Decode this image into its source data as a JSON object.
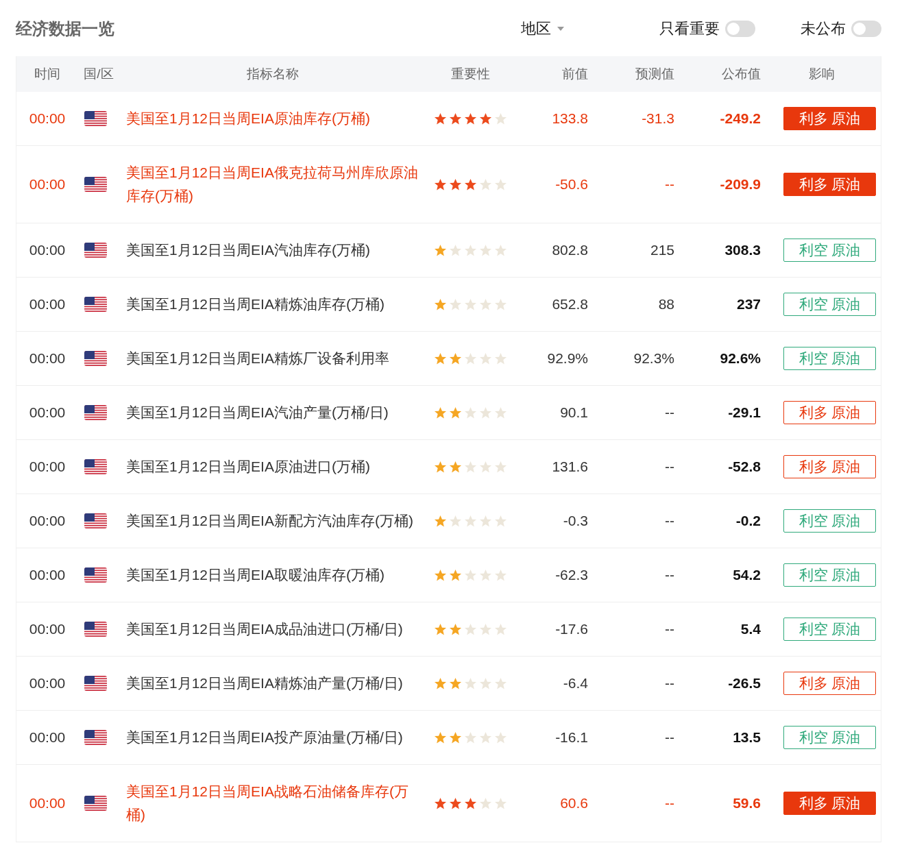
{
  "title": "经济数据一览",
  "filters": {
    "region": {
      "label": "地区"
    },
    "toggles": [
      {
        "label": "只看重要",
        "on": false
      },
      {
        "label": "未公布",
        "on": false
      }
    ]
  },
  "columns": [
    "时间",
    "国/区",
    "指标名称",
    "重要性",
    "前值",
    "预测值",
    "公布值",
    "影响"
  ],
  "rows": [
    {
      "time": "00:00",
      "highlight": true,
      "name": "美国至1月12日当周EIA原油库存(万桶)",
      "stars": 4,
      "previous": "133.8",
      "forecast": "-31.3",
      "actual": "-249.2",
      "impact": {
        "label": "利多 原油",
        "kind": "bullish",
        "filled": true
      }
    },
    {
      "time": "00:00",
      "highlight": true,
      "name": "美国至1月12日当周EIA俄克拉荷马州库欣原油库存(万桶)",
      "stars": 3,
      "previous": "-50.6",
      "forecast": "--",
      "actual": "-209.9",
      "impact": {
        "label": "利多 原油",
        "kind": "bullish",
        "filled": true
      }
    },
    {
      "time": "00:00",
      "highlight": false,
      "name": "美国至1月12日当周EIA汽油库存(万桶)",
      "stars": 1,
      "previous": "802.8",
      "forecast": "215",
      "actual": "308.3",
      "impact": {
        "label": "利空 原油",
        "kind": "bearish",
        "filled": false
      }
    },
    {
      "time": "00:00",
      "highlight": false,
      "name": "美国至1月12日当周EIA精炼油库存(万桶)",
      "stars": 1,
      "previous": "652.8",
      "forecast": "88",
      "actual": "237",
      "impact": {
        "label": "利空 原油",
        "kind": "bearish",
        "filled": false
      }
    },
    {
      "time": "00:00",
      "highlight": false,
      "name": "美国至1月12日当周EIA精炼厂设备利用率",
      "stars": 2,
      "previous": "92.9%",
      "forecast": "92.3%",
      "actual": "92.6%",
      "impact": {
        "label": "利空 原油",
        "kind": "bearish",
        "filled": false
      }
    },
    {
      "time": "00:00",
      "highlight": false,
      "name": "美国至1月12日当周EIA汽油产量(万桶/日)",
      "stars": 2,
      "previous": "90.1",
      "forecast": "--",
      "actual": "-29.1",
      "impact": {
        "label": "利多 原油",
        "kind": "bullish",
        "filled": false
      }
    },
    {
      "time": "00:00",
      "highlight": false,
      "name": "美国至1月12日当周EIA原油进口(万桶)",
      "stars": 2,
      "previous": "131.6",
      "forecast": "--",
      "actual": "-52.8",
      "impact": {
        "label": "利多 原油",
        "kind": "bullish",
        "filled": false
      }
    },
    {
      "time": "00:00",
      "highlight": false,
      "name": "美国至1月12日当周EIA新配方汽油库存(万桶)",
      "stars": 1,
      "previous": "-0.3",
      "forecast": "--",
      "actual": "-0.2",
      "impact": {
        "label": "利空 原油",
        "kind": "bearish",
        "filled": false
      }
    },
    {
      "time": "00:00",
      "highlight": false,
      "name": "美国至1月12日当周EIA取暖油库存(万桶)",
      "stars": 2,
      "previous": "-62.3",
      "forecast": "--",
      "actual": "54.2",
      "impact": {
        "label": "利空 原油",
        "kind": "bearish",
        "filled": false
      }
    },
    {
      "time": "00:00",
      "highlight": false,
      "name": "美国至1月12日当周EIA成品油进口(万桶/日)",
      "stars": 2,
      "previous": "-17.6",
      "forecast": "--",
      "actual": "5.4",
      "impact": {
        "label": "利空 原油",
        "kind": "bearish",
        "filled": false
      }
    },
    {
      "time": "00:00",
      "highlight": false,
      "name": "美国至1月12日当周EIA精炼油产量(万桶/日)",
      "stars": 2,
      "previous": "-6.4",
      "forecast": "--",
      "actual": "-26.5",
      "impact": {
        "label": "利多 原油",
        "kind": "bullish",
        "filled": false
      }
    },
    {
      "time": "00:00",
      "highlight": false,
      "name": "美国至1月12日当周EIA投产原油量(万桶/日)",
      "stars": 2,
      "previous": "-16.1",
      "forecast": "--",
      "actual": "13.5",
      "impact": {
        "label": "利空 原油",
        "kind": "bearish",
        "filled": false
      }
    },
    {
      "time": "00:00",
      "highlight": true,
      "name": "美国至1月12日当周EIA战略石油储备库存(万桶)",
      "stars": 3,
      "previous": "60.6",
      "forecast": "--",
      "actual": "59.6",
      "impact": {
        "label": "利多 原油",
        "kind": "bullish",
        "filled": true
      }
    }
  ]
}
